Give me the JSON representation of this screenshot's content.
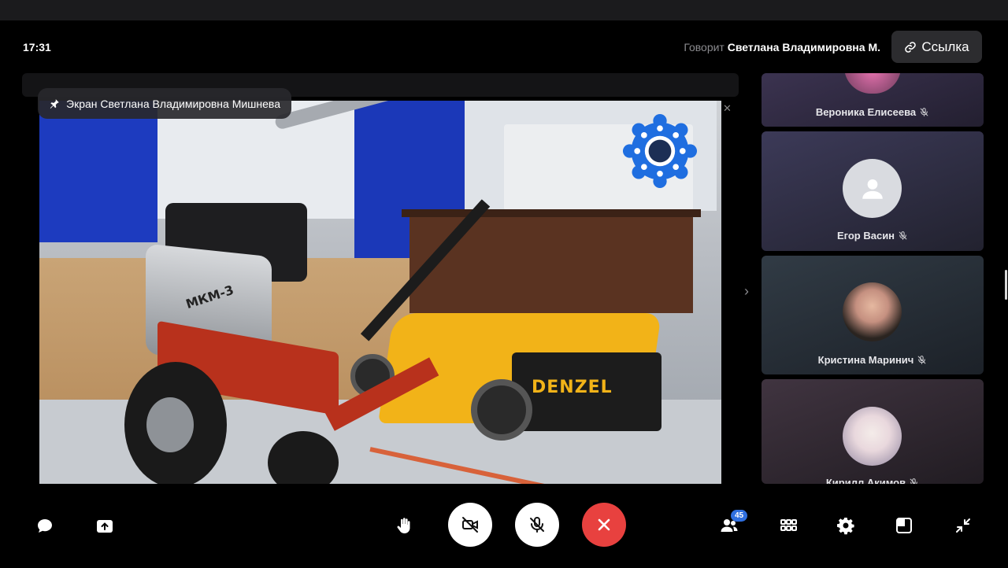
{
  "header": {
    "time": "17:31",
    "speaking_prefix": "Говорит",
    "speaking_name": "Светлана Владимировна М.",
    "link_label": "Ссылка"
  },
  "screen_share": {
    "pin_label": "Экран Светлана Владимировна Мишнева",
    "tiller_label": "МКМ-3",
    "mower_brand": "DENZEL"
  },
  "participants": [
    {
      "name": "Вероника Елисеева",
      "mic": "muted",
      "avatar": "photo"
    },
    {
      "name": "Егор Васин",
      "mic": "muted",
      "avatar": "default"
    },
    {
      "name": "Кристина Маринич",
      "mic": "muted",
      "avatar": "photo"
    },
    {
      "name": "Кирилл Акимов",
      "mic": "muted",
      "avatar": "anime"
    }
  ],
  "controls": {
    "participants_count": "45"
  },
  "colors": {
    "end_call": "#e8413f",
    "badge": "#2f6fe0",
    "panel": "#2c2c2f"
  }
}
